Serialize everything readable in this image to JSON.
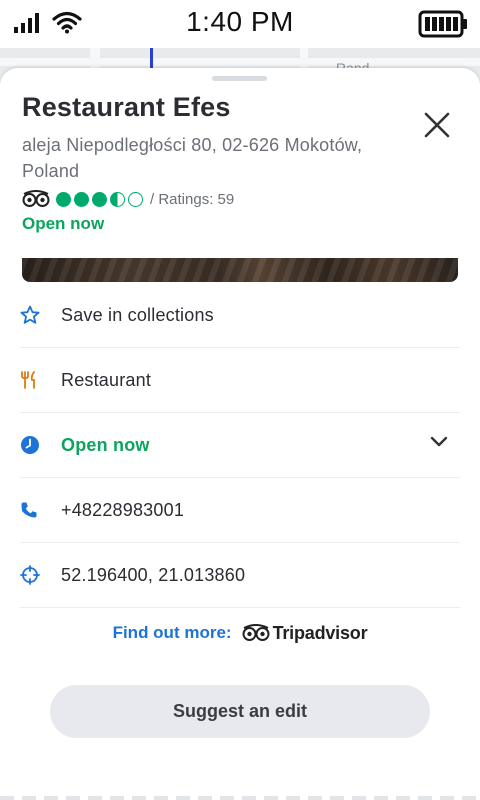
{
  "status_bar": {
    "time": "1:40 PM"
  },
  "map": {
    "visible_label": "Rand"
  },
  "place": {
    "name": "Restaurant Efes",
    "address": "aleja Niepodległości 80, 02-626 Mokotów, Poland",
    "rating": {
      "value": 3.5,
      "max": 5,
      "ratings_text": "/ Ratings: 59"
    },
    "open_status": "Open now"
  },
  "details": {
    "save": "Save in collections",
    "category": "Restaurant",
    "hours": "Open now",
    "phone": "+48228983001",
    "coordinates": "52.196400, 21.013860"
  },
  "find_more": {
    "label": "Find out more:",
    "provider": "Tripadvisor"
  },
  "suggest_edit": "Suggest an edit",
  "icons": {
    "save": "star-outline-icon",
    "category": "fork-knife-icon",
    "hours": "clock-icon",
    "phone": "phone-icon",
    "coordinates": "crosshair-icon",
    "close": "close-icon",
    "expand": "chevron-down-icon"
  },
  "colors": {
    "accent_blue": "#1e73d8",
    "open_green": "#0ba55e",
    "rating_green": "#00aa6c",
    "category_orange": "#e07b12"
  }
}
